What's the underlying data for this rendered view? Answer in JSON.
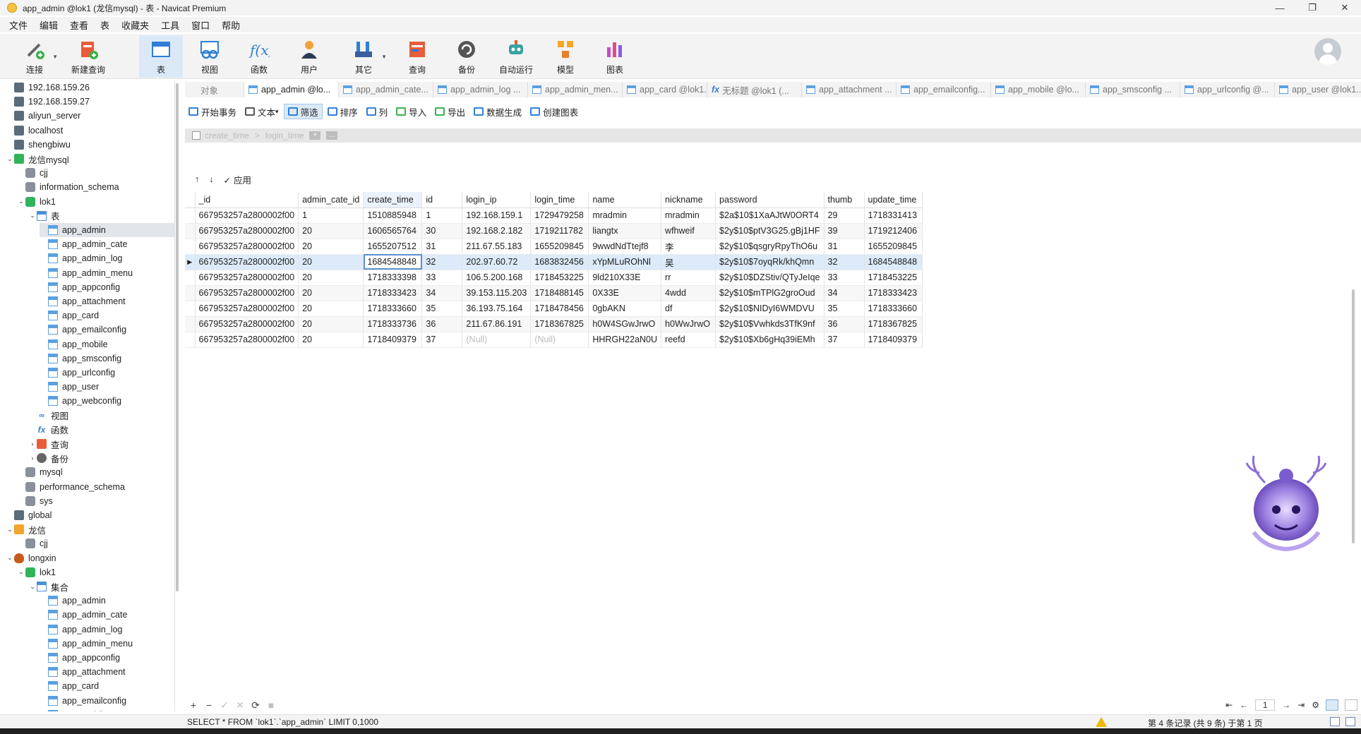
{
  "window": {
    "title": "app_admin @lok1 (龙信mysql) - 表 - Navicat Premium",
    "controls": [
      "—",
      "❐",
      "✕"
    ]
  },
  "menu": [
    "文件",
    "编辑",
    "查看",
    "表",
    "收藏夹",
    "工具",
    "窗口",
    "帮助"
  ],
  "ribbon": [
    {
      "label": "连接",
      "icon": "connection-icon",
      "caret": true
    },
    {
      "label": "新建查询",
      "icon": "new-query-icon"
    },
    {
      "label": "表",
      "icon": "table-icon",
      "active": true
    },
    {
      "label": "视图",
      "icon": "view-icon"
    },
    {
      "label": "函数",
      "icon": "function-icon"
    },
    {
      "label": "用户",
      "icon": "user-icon"
    },
    {
      "label": "其它",
      "icon": "other-icon",
      "caret": true
    },
    {
      "label": "查询",
      "icon": "query-icon"
    },
    {
      "label": "备份",
      "icon": "backup-icon"
    },
    {
      "label": "自动运行",
      "icon": "robot-icon"
    },
    {
      "label": "模型",
      "icon": "model-icon"
    },
    {
      "label": "图表",
      "icon": "chart-icon"
    }
  ],
  "tree": [
    {
      "label": "192.168.159.26",
      "icon": "conn",
      "level": 0
    },
    {
      "label": "192.168.159.27",
      "icon": "conn",
      "level": 0
    },
    {
      "label": "aliyun_server",
      "icon": "conn",
      "level": 0
    },
    {
      "label": "localhost",
      "icon": "conn",
      "level": 0
    },
    {
      "label": "shengbiwu",
      "icon": "conn",
      "level": 0
    },
    {
      "label": "龙信mysql",
      "icon": "conn-green",
      "level": 0,
      "expanded": true
    },
    {
      "label": "cjj",
      "icon": "db",
      "level": 1
    },
    {
      "label": "information_schema",
      "icon": "db",
      "level": 1
    },
    {
      "label": "lok1",
      "icon": "db-green",
      "level": 1,
      "expanded": true
    },
    {
      "label": "表",
      "icon": "tablegroup",
      "level": 2,
      "expanded": true
    },
    {
      "label": "app_admin",
      "icon": "table",
      "level": 3,
      "selected": true
    },
    {
      "label": "app_admin_cate",
      "icon": "table",
      "level": 3
    },
    {
      "label": "app_admin_log",
      "icon": "table",
      "level": 3
    },
    {
      "label": "app_admin_menu",
      "icon": "table",
      "level": 3
    },
    {
      "label": "app_appconfig",
      "icon": "table",
      "level": 3
    },
    {
      "label": "app_attachment",
      "icon": "table",
      "level": 3
    },
    {
      "label": "app_card",
      "icon": "table",
      "level": 3
    },
    {
      "label": "app_emailconfig",
      "icon": "table",
      "level": 3
    },
    {
      "label": "app_mobile",
      "icon": "table",
      "level": 3
    },
    {
      "label": "app_smsconfig",
      "icon": "table",
      "level": 3
    },
    {
      "label": "app_urlconfig",
      "icon": "table",
      "level": 3
    },
    {
      "label": "app_user",
      "icon": "table",
      "level": 3
    },
    {
      "label": "app_webconfig",
      "icon": "table",
      "level": 3
    },
    {
      "label": "视图",
      "icon": "view",
      "level": 2
    },
    {
      "label": "函数",
      "icon": "func",
      "level": 2
    },
    {
      "label": "查询",
      "icon": "query",
      "level": 2,
      "collapsed": true
    },
    {
      "label": "备份",
      "icon": "backup",
      "level": 2,
      "collapsed": true
    },
    {
      "label": "mysql",
      "icon": "db",
      "level": 1
    },
    {
      "label": "performance_schema",
      "icon": "db",
      "level": 1
    },
    {
      "label": "sys",
      "icon": "db",
      "level": 1
    },
    {
      "label": "global",
      "icon": "conn",
      "level": 0
    },
    {
      "label": "龙信",
      "icon": "conn-orange",
      "level": 0,
      "expanded": true
    },
    {
      "label": "cjj",
      "icon": "db",
      "level": 1
    },
    {
      "label": "longxin",
      "icon": "conn-mongo",
      "level": 0,
      "expanded": true
    },
    {
      "label": "lok1",
      "icon": "db-green",
      "level": 1,
      "expanded": true
    },
    {
      "label": "集合",
      "icon": "tablegroup",
      "level": 2,
      "expanded": true
    },
    {
      "label": "app_admin",
      "icon": "table",
      "level": 3
    },
    {
      "label": "app_admin_cate",
      "icon": "table",
      "level": 3
    },
    {
      "label": "app_admin_log",
      "icon": "table",
      "level": 3
    },
    {
      "label": "app_admin_menu",
      "icon": "table",
      "level": 3
    },
    {
      "label": "app_appconfig",
      "icon": "table",
      "level": 3
    },
    {
      "label": "app_attachment",
      "icon": "table",
      "level": 3
    },
    {
      "label": "app_card",
      "icon": "table",
      "level": 3
    },
    {
      "label": "app_emailconfig",
      "icon": "table",
      "level": 3
    },
    {
      "label": "app_mobile",
      "icon": "table",
      "level": 3
    }
  ],
  "tabs": [
    {
      "label": "对象",
      "kind": "object"
    },
    {
      "label": "app_admin @lo...",
      "kind": "table",
      "active": true
    },
    {
      "label": "app_admin_cate...",
      "kind": "table"
    },
    {
      "label": "app_admin_log ...",
      "kind": "table"
    },
    {
      "label": "app_admin_men...",
      "kind": "table"
    },
    {
      "label": "app_card @lok1...",
      "kind": "table"
    },
    {
      "label": "无标题 @lok1 (...",
      "kind": "func"
    },
    {
      "label": "app_attachment ...",
      "kind": "table"
    },
    {
      "label": "app_emailconfig...",
      "kind": "table"
    },
    {
      "label": "app_mobile @lo...",
      "kind": "table"
    },
    {
      "label": "app_smsconfig ...",
      "kind": "table"
    },
    {
      "label": "app_urlconfig @...",
      "kind": "table"
    },
    {
      "label": "app_user @lok1...",
      "kind": "table"
    }
  ],
  "toolbar2": [
    {
      "label": "开始事务",
      "name": "begin-transaction-button",
      "icon": "transaction-icon"
    },
    {
      "label": "文本",
      "name": "text-button",
      "icon": "text-icon",
      "caret": true
    },
    {
      "label": "筛选",
      "name": "filter-button",
      "icon": "filter-icon",
      "active": true
    },
    {
      "label": "排序",
      "name": "sort-button",
      "icon": "sort-icon"
    },
    {
      "label": "列",
      "name": "columns-button",
      "icon": "columns-icon"
    },
    {
      "label": "导入",
      "name": "import-button",
      "icon": "import-icon"
    },
    {
      "label": "导出",
      "name": "export-button",
      "icon": "export-icon"
    },
    {
      "label": "数据生成",
      "name": "data-generation-button",
      "icon": "data-gen-icon"
    },
    {
      "label": "创建图表",
      "name": "create-chart-button",
      "icon": "chart-icon"
    }
  ],
  "filter": {
    "field1": "create_time",
    "sep": ">",
    "field2": "login_time"
  },
  "sortrow": {
    "up": "↑",
    "down": "↓",
    "apply": "应用"
  },
  "grid": {
    "columns": [
      "_id",
      "admin_cate_id",
      "create_time",
      "id",
      "login_ip",
      "login_time",
      "name",
      "nickname",
      "password",
      "thumb",
      "update_time"
    ],
    "widths": [
      123,
      91,
      83,
      57,
      95,
      82,
      100,
      77,
      123,
      57,
      82
    ],
    "sorted_column": 2,
    "current_row": 3,
    "rows": [
      [
        "667953257a2800002f00",
        "1",
        "1510885948",
        "1",
        "192.168.159.1",
        "1729479258",
        "mradmin",
        "mradmin",
        "$2a$10$1XaAJtW0ORT4",
        "29",
        "1718331413"
      ],
      [
        "667953257a2800002f00",
        "20",
        "1606565764",
        "30",
        "192.168.2.182",
        "1719211782",
        "liangtx",
        "wfhweif",
        "$2y$10$ptV3G25.gBj1HF",
        "39",
        "1719212406"
      ],
      [
        "667953257a2800002f00",
        "20",
        "1655207512",
        "31",
        "211.67.55.183",
        "1655209845",
        "9wwdNdTtejf8",
        "李",
        "$2y$10$qsgryRpyThO6u",
        "31",
        "1655209845"
      ],
      [
        "667953257a2800002f00",
        "20",
        "1684548848",
        "32",
        "202.97.60.72",
        "1683832456",
        "xYpMLuROhNl",
        "吴",
        "$2y$10$7oyqRk/khQmn",
        "32",
        "1684548848"
      ],
      [
        "667953257a2800002f00",
        "20",
        "1718333398",
        "33",
        "106.5.200.168",
        "1718453225",
        "9ld210X33E",
        "rr",
        "$2y$10$DZStiv/QTyJeIqe",
        "33",
        "1718453225"
      ],
      [
        "667953257a2800002f00",
        "20",
        "1718333423",
        "34",
        "39.153.115.203",
        "1718488145",
        "0X33E",
        "4wdd",
        "$2y$10$mTPlG2groOud",
        "34",
        "1718333423"
      ],
      [
        "667953257a2800002f00",
        "20",
        "1718333660",
        "35",
        "36.193.75.164",
        "1718478456",
        "0gbAKN",
        "df",
        "$2y$10$NIDyI6WMDVU",
        "35",
        "1718333660"
      ],
      [
        "667953257a2800002f00",
        "20",
        "1718333736",
        "36",
        "211.67.86.191",
        "1718367825",
        "h0W4SGwJrwO",
        "h0WwJrwO",
        "$2y$10$Vwhkds3TfK9nf",
        "36",
        "1718367825"
      ],
      [
        "667953257a2800002f00",
        "20",
        "1718409379",
        "37",
        "(Null)",
        "(Null)",
        "HHRGH22aN0U",
        "reefd",
        "$2y$10$Xb6gHq39iEMh",
        "37",
        "1718409379"
      ]
    ]
  },
  "bottombar": {
    "buttons": [
      "+",
      "−",
      "✓",
      "✕",
      "⟳",
      "■"
    ],
    "pager": {
      "first": "⇤",
      "prev": "←",
      "page": "1",
      "next": "→",
      "last": "⇥",
      "settings": "⚙"
    }
  },
  "status": {
    "sql": "SELECT * FROM `lok1`.`app_admin` LIMIT 0,1000",
    "records": "第 4 条记录 (共 9 条) 于第 1 页"
  },
  "colors": {
    "accent": "#dbe9f7",
    "selection": "#dceaf9",
    "edit_outline": "#5d8fd0"
  }
}
